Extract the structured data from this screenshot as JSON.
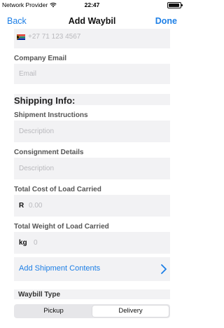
{
  "status_bar": {
    "carrier": "Network Provider",
    "time": "22:47"
  },
  "nav": {
    "back": "Back",
    "title": "Add Waybil",
    "done": "Done"
  },
  "phone": {
    "code": "+27",
    "placeholder": "71 123 4567"
  },
  "company_email": {
    "label": "Company Email",
    "placeholder": "Email"
  },
  "section": {
    "title": "Shipping Info:"
  },
  "shipment_instructions": {
    "label": "Shipment Instructions",
    "placeholder": "Description"
  },
  "consignment_details": {
    "label": "Consignment Details",
    "placeholder": "Description"
  },
  "total_cost": {
    "label": "Total Cost of Load Carried",
    "prefix": "R",
    "placeholder": "0.00"
  },
  "total_weight": {
    "label": "Total Weight of Load Carried",
    "prefix": "kg",
    "placeholder": "0"
  },
  "add_contents": {
    "label": "Add Shipment Contents"
  },
  "waybill_type": {
    "label": "Waybill Type",
    "options": [
      "Pickup",
      "Delivery"
    ],
    "selected": "Delivery"
  },
  "colors": {
    "accent": "#1d7fe6",
    "field_bg": "#f2f2f4"
  }
}
